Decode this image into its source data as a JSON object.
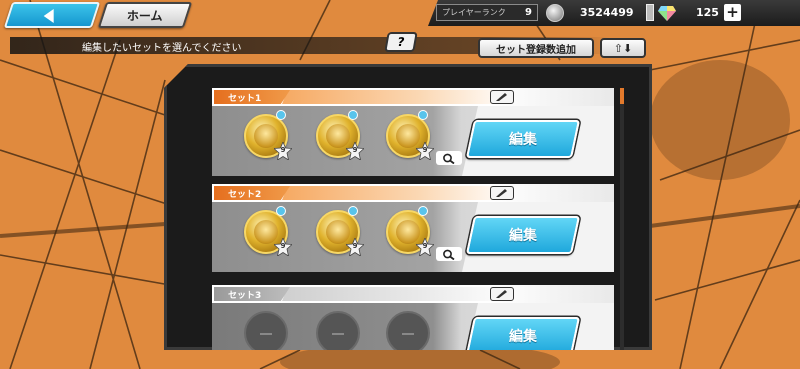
{
  "header": {
    "home_label": "ホーム",
    "rank_label": "プレイヤーランク",
    "rank_value": "9",
    "coins": "3524499",
    "gems": "125",
    "plus": "+"
  },
  "instructions": "編集したいセットを選んでください",
  "help_label": "?",
  "add_sets_label": "セット登録数追加",
  "sort_label": "⇧⬇",
  "sets": [
    {
      "name": "セット1",
      "edit_label": "編集",
      "filled": true,
      "medals": [
        {
          "star_level": "9"
        },
        {
          "star_level": "9"
        },
        {
          "star_level": "9"
        }
      ]
    },
    {
      "name": "セット2",
      "edit_label": "編集",
      "filled": true,
      "medals": [
        {
          "star_level": "9"
        },
        {
          "star_level": "9"
        },
        {
          "star_level": "9"
        }
      ]
    },
    {
      "name": "セット3",
      "edit_label": "編集",
      "filled": false,
      "medals": []
    }
  ],
  "colors": {
    "background": "#e08a3e",
    "accent_blue": "#1fa8dc",
    "set_tab_orange": "#e56f1f",
    "set_tab_gray": "#9a9a9a",
    "medal_gold": "#e0b22c"
  }
}
